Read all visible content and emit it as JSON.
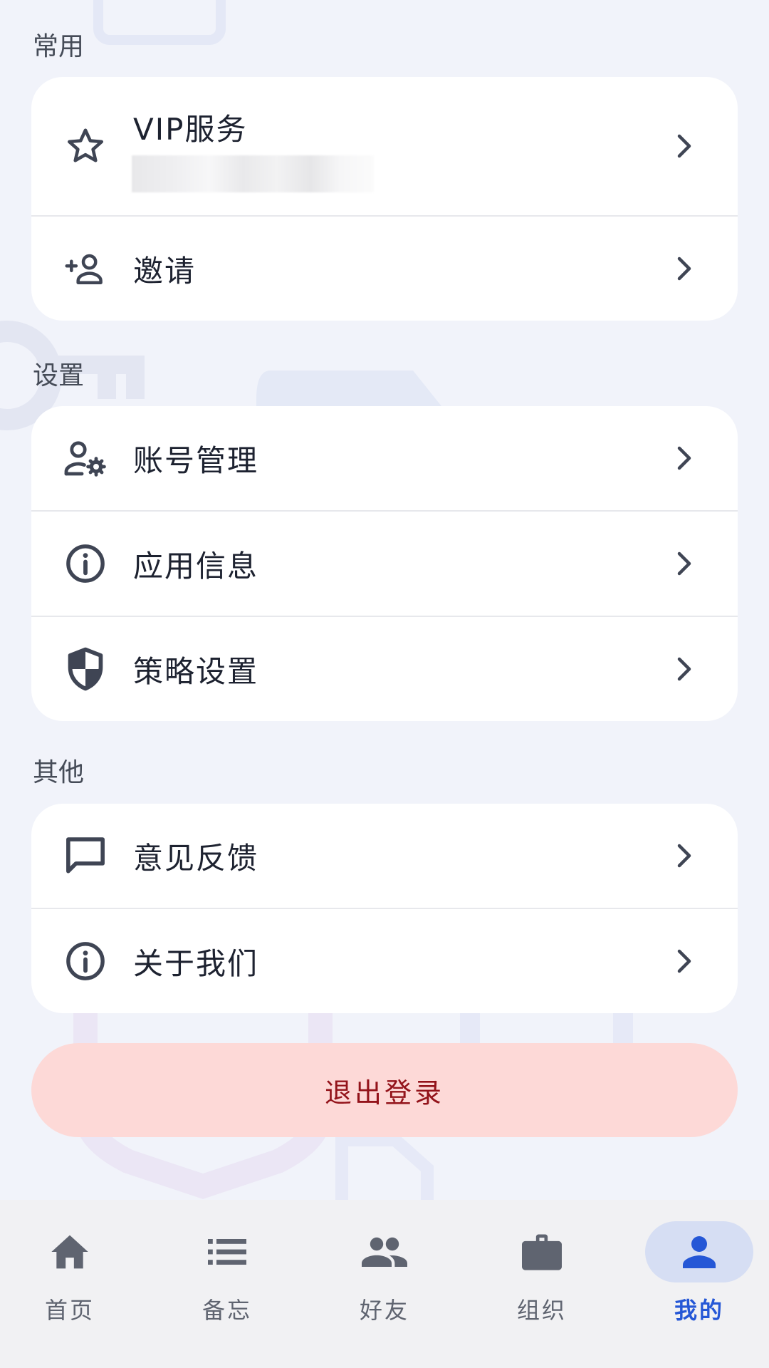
{
  "sections": {
    "common_title": "常用",
    "settings_title": "设置",
    "other_title": "其他"
  },
  "common": {
    "vip_label": "VIP服务",
    "invite_label": "邀请"
  },
  "settings": {
    "account_label": "账号管理",
    "app_info_label": "应用信息",
    "policy_label": "策略设置"
  },
  "other": {
    "feedback_label": "意见反馈",
    "about_label": "关于我们"
  },
  "logout_label": "退出登录",
  "tabbar": {
    "home": "首页",
    "memo": "备忘",
    "friends": "好友",
    "org": "组织",
    "mine": "我的",
    "active_tab": "mine"
  },
  "colors": {
    "background": "#f1f3fa",
    "icon": "#3f4554",
    "logout_bg": "#fdd9d7",
    "logout_text": "#93131a",
    "active_tab": "#2557d6",
    "active_tab_bg": "#d6def3"
  }
}
